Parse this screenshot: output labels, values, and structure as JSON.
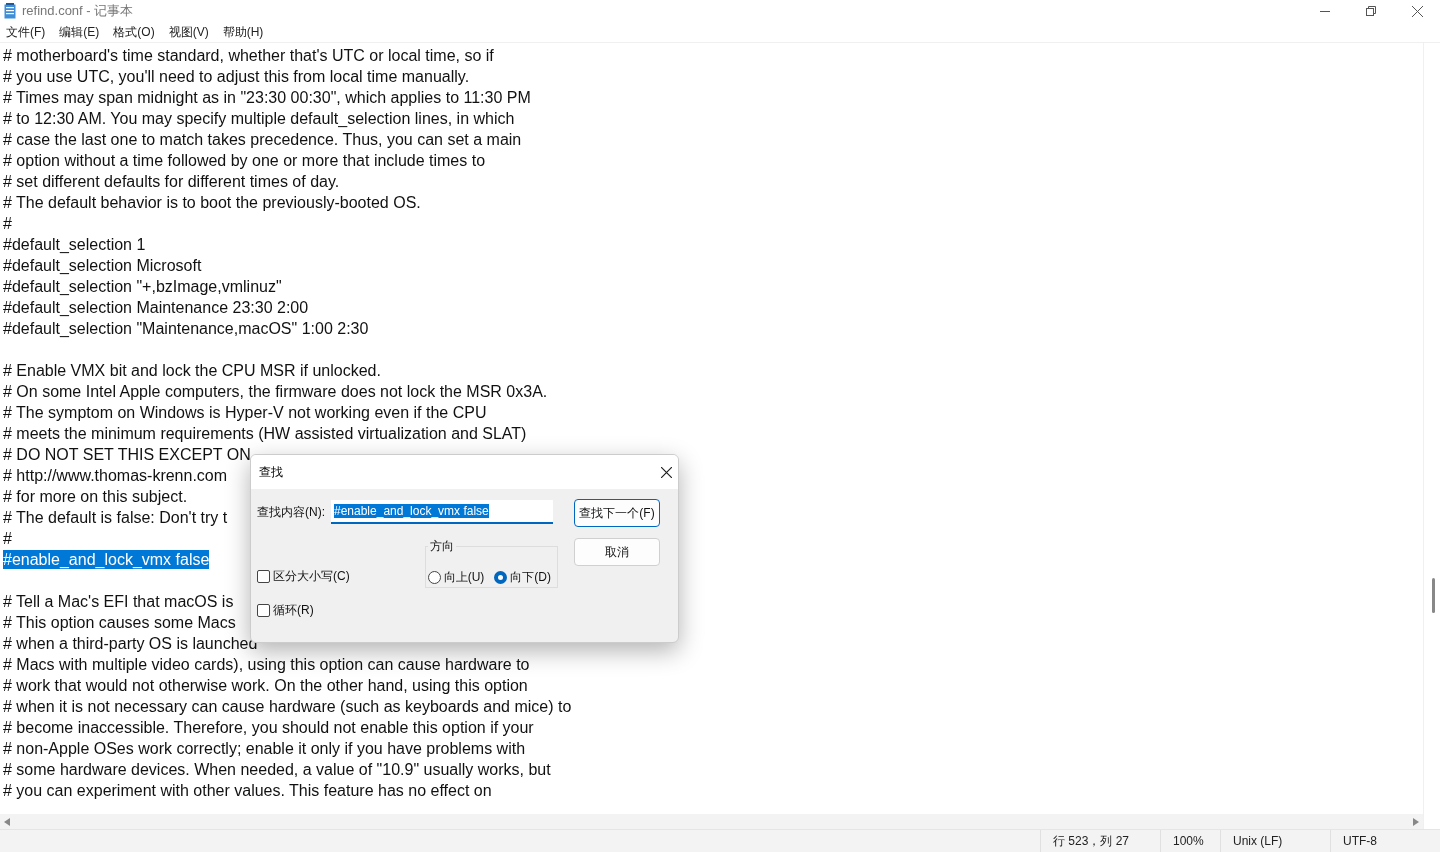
{
  "window": {
    "title": "refind.conf - 记事本"
  },
  "menu": [
    "文件(F)",
    "编辑(E)",
    "格式(O)",
    "视图(V)",
    "帮助(H)"
  ],
  "editor": {
    "paragraphs": [
      {
        "lines": [
          {
            "text": "# motherboard's time standard, whether that's UTC or local time, so if",
            "selected": false
          },
          {
            "text": "# you use UTC, you'll need to adjust this from local time manually.",
            "selected": false
          },
          {
            "text": "# Times may span midnight as in \"23:30 00:30\", which applies to 11:30 PM",
            "selected": false
          },
          {
            "text": "# to 12:30 AM. You may specify multiple default_selection lines, in which",
            "selected": false
          },
          {
            "text": "# case the last one to match takes precedence. Thus, you can set a main",
            "selected": false
          },
          {
            "text": "# option without a time followed by one or more that include times to",
            "selected": false
          },
          {
            "text": "# set different defaults for different times of day.",
            "selected": false
          },
          {
            "text": "# The default behavior is to boot the previously-booted OS.",
            "selected": false
          },
          {
            "text": "#",
            "selected": false
          },
          {
            "text": "#default_selection 1",
            "selected": false
          },
          {
            "text": "#default_selection Microsoft",
            "selected": false
          },
          {
            "text": "#default_selection \"+,bzImage,vmlinuz\"",
            "selected": false
          },
          {
            "text": "#default_selection Maintenance 23:30 2:00",
            "selected": false
          },
          {
            "text": "#default_selection \"Maintenance,macOS\" 1:00 2:30",
            "selected": false
          }
        ]
      },
      {
        "lines": [
          {
            "text": "# Enable VMX bit and lock the CPU MSR if unlocked.",
            "selected": false
          },
          {
            "text": "# On some Intel Apple computers, the firmware does not lock the MSR 0x3A.",
            "selected": false
          },
          {
            "text": "# The symptom on Windows is Hyper-V not working even if the CPU",
            "selected": false
          },
          {
            "text": "# meets the minimum requirements (HW assisted virtualization and SLAT)",
            "selected": false
          },
          {
            "text": "# DO NOT SET THIS EXCEPT ON",
            "selected": false
          },
          {
            "text": "# http://www.thomas-krenn.com",
            "selected": false
          },
          {
            "text": "# for more on this subject.",
            "selected": false
          },
          {
            "text": "# The default is false: Don't try t",
            "selected": false
          },
          {
            "text": "#",
            "selected": false
          },
          {
            "text": "#enable_and_lock_vmx false",
            "selected": true
          }
        ]
      },
      {
        "lines": [
          {
            "text": "# Tell a Mac's EFI that macOS is",
            "selected": false
          },
          {
            "text": "# This option causes some Macs",
            "selected": false
          },
          {
            "text": "# when a third-party OS is launched",
            "selected": false
          },
          {
            "text": "# Macs with multiple video cards), using this option can cause hardware to",
            "selected": false
          },
          {
            "text": "# work that would not otherwise work. On the other hand, using this option",
            "selected": false
          },
          {
            "text": "# when it is not necessary can cause hardware (such as keyboards and mice) to",
            "selected": false
          },
          {
            "text": "# become inaccessible. Therefore, you should not enable this option if your",
            "selected": false
          },
          {
            "text": "# non-Apple OSes work correctly; enable it only if you have problems with",
            "selected": false
          },
          {
            "text": "# some hardware devices. When needed, a value of \"10.9\" usually works, but",
            "selected": false
          },
          {
            "text": "# you can experiment with other values. This feature has no effect on",
            "selected": false
          }
        ]
      }
    ]
  },
  "find_dialog": {
    "title": "查找",
    "find_label": "查找内容(N):",
    "find_value": "#enable_and_lock_vmx false",
    "find_next_button": "查找下一个(F)",
    "cancel_button": "取消",
    "direction": {
      "label": "方向",
      "options": [
        {
          "label": "向上(U)",
          "selected": false
        },
        {
          "label": "向下(D)",
          "selected": true
        }
      ]
    },
    "match_case": {
      "label": "区分大小写(C)",
      "checked": false
    },
    "wrap": {
      "label": "循环(R)",
      "checked": false
    }
  },
  "status_bar": [
    "行 523，列 27",
    "100%",
    "Unix (LF)",
    "UTF-8"
  ]
}
